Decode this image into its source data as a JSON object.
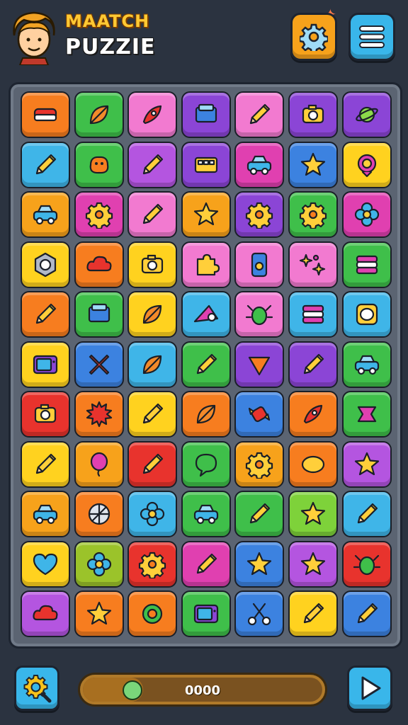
{
  "header": {
    "title_line1": "MAATCH",
    "title_line2": "PUZZIE"
  },
  "footer": {
    "score": "0000",
    "progress": 0.25
  },
  "board": {
    "rows": [
      [
        {
          "c": "#f77d1f",
          "i": "bed"
        },
        {
          "c": "#3fbf4a",
          "i": "leaf"
        },
        {
          "c": "#f27ad0",
          "i": "rocket"
        },
        {
          "c": "#8b45d6",
          "i": "box"
        },
        {
          "c": "#f27ad0",
          "i": "pencil"
        },
        {
          "c": "#8b45d6",
          "i": "camera"
        },
        {
          "c": "#8b45d6",
          "i": "planet"
        }
      ],
      [
        {
          "c": "#3fb5e8",
          "i": "pencil"
        },
        {
          "c": "#3fbf4a",
          "i": "blob"
        },
        {
          "c": "#b455e0",
          "i": "pencil"
        },
        {
          "c": "#8b45d6",
          "i": "radio"
        },
        {
          "c": "#e040b0",
          "i": "car"
        },
        {
          "c": "#3c82e0",
          "i": "star"
        },
        {
          "c": "#ffd21f",
          "i": "target"
        }
      ],
      [
        {
          "c": "#f7a21b",
          "i": "car"
        },
        {
          "c": "#e040b0",
          "i": "gear"
        },
        {
          "c": "#f27ad0",
          "i": "pencil"
        },
        {
          "c": "#f7a21b",
          "i": "star"
        },
        {
          "c": "#8b45d6",
          "i": "gear"
        },
        {
          "c": "#3fbf4a",
          "i": "gear"
        },
        {
          "c": "#e040b0",
          "i": "flower"
        }
      ],
      [
        {
          "c": "#ffd21f",
          "i": "nut"
        },
        {
          "c": "#f77d1f",
          "i": "cloud"
        },
        {
          "c": "#ffd21f",
          "i": "camera"
        },
        {
          "c": "#f27ad0",
          "i": "puzzle"
        },
        {
          "c": "#f27ad0",
          "i": "phone"
        },
        {
          "c": "#f27ad0",
          "i": "sparkles"
        },
        {
          "c": "#3fbf4a",
          "i": "stack"
        }
      ],
      [
        {
          "c": "#f77d1f",
          "i": "pencil"
        },
        {
          "c": "#3fbf4a",
          "i": "box"
        },
        {
          "c": "#ffd21f",
          "i": "leaf"
        },
        {
          "c": "#3fb5e8",
          "i": "cheese"
        },
        {
          "c": "#f27ad0",
          "i": "bug"
        },
        {
          "c": "#3fb5e8",
          "i": "stack"
        },
        {
          "c": "#3fb5e8",
          "i": "egg"
        }
      ],
      [
        {
          "c": "#ffd21f",
          "i": "tv"
        },
        {
          "c": "#3c82e0",
          "i": "cross"
        },
        {
          "c": "#3fb5e8",
          "i": "leaf"
        },
        {
          "c": "#3fbf4a",
          "i": "pencil"
        },
        {
          "c": "#8b45d6",
          "i": "triangle"
        },
        {
          "c": "#8b45d6",
          "i": "pencil"
        },
        {
          "c": "#3fbf4a",
          "i": "car"
        }
      ],
      [
        {
          "c": "#e8332d",
          "i": "camera"
        },
        {
          "c": "#f77d1f",
          "i": "burst"
        },
        {
          "c": "#ffd21f",
          "i": "pencil"
        },
        {
          "c": "#f77d1f",
          "i": "leaf"
        },
        {
          "c": "#3c82e0",
          "i": "candy"
        },
        {
          "c": "#f77d1f",
          "i": "rocket"
        },
        {
          "c": "#3fbf4a",
          "i": "ribbon"
        }
      ],
      [
        {
          "c": "#ffd21f",
          "i": "pencil"
        },
        {
          "c": "#f7a21b",
          "i": "balloon"
        },
        {
          "c": "#e8332d",
          "i": "pencil"
        },
        {
          "c": "#3fbf4a",
          "i": "bubble"
        },
        {
          "c": "#f7a21b",
          "i": "gear"
        },
        {
          "c": "#f77d1f",
          "i": "oval"
        },
        {
          "c": "#b455e0",
          "i": "star"
        }
      ],
      [
        {
          "c": "#f7a21b",
          "i": "car"
        },
        {
          "c": "#f77d1f",
          "i": "wheel"
        },
        {
          "c": "#3fb5e8",
          "i": "flower"
        },
        {
          "c": "#3fbf4a",
          "i": "car"
        },
        {
          "c": "#3fbf4a",
          "i": "pencil"
        },
        {
          "c": "#7ed23a",
          "i": "star"
        },
        {
          "c": "#3fb5e8",
          "i": "pencil"
        }
      ],
      [
        {
          "c": "#ffd21f",
          "i": "heart"
        },
        {
          "c": "#9bc32a",
          "i": "flower"
        },
        {
          "c": "#e8332d",
          "i": "gear"
        },
        {
          "c": "#e040b0",
          "i": "pencil"
        },
        {
          "c": "#3c82e0",
          "i": "star"
        },
        {
          "c": "#b455e0",
          "i": "star"
        },
        {
          "c": "#e8332d",
          "i": "bug"
        }
      ],
      [
        {
          "c": "#b455e0",
          "i": "cloud"
        },
        {
          "c": "#f77d1f",
          "i": "star"
        },
        {
          "c": "#f77d1f",
          "i": "ring"
        },
        {
          "c": "#3fbf4a",
          "i": "tv"
        },
        {
          "c": "#3c82e0",
          "i": "scissors"
        },
        {
          "c": "#ffd21f",
          "i": "pencil"
        },
        {
          "c": "#3c82e0",
          "i": "pencil"
        }
      ]
    ]
  }
}
